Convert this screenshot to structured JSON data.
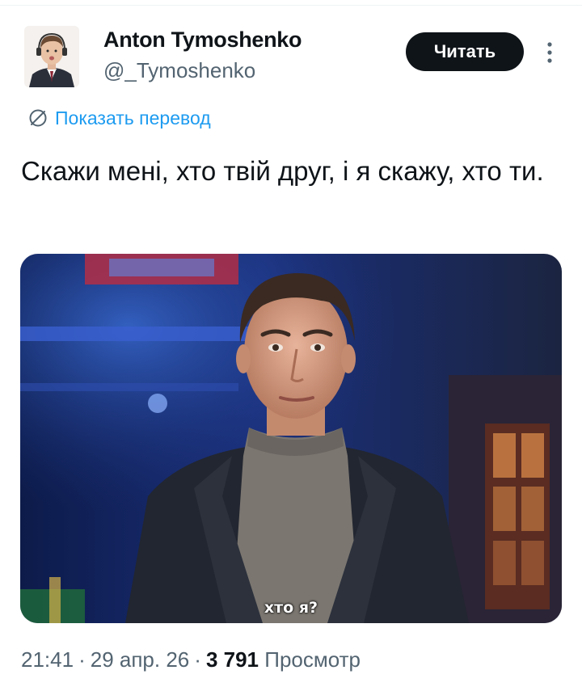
{
  "author": {
    "name": "Anton Tymoshenko",
    "handle": "@_Tymoshenko"
  },
  "follow_button": {
    "label": "Читать"
  },
  "more_icon": "more-vertical-icon",
  "translate": {
    "icon": "translate-globe-icon",
    "label": "Показать перевод"
  },
  "tweet": {
    "text": "Скажи мені, хто твій друг, і я скажу, хто ти."
  },
  "media": {
    "subtitle": "хто я?"
  },
  "meta": {
    "time": "21:41",
    "separator": "·",
    "date": "29 апр. 26",
    "views_count": "3 791",
    "views_label": "Просмотр"
  },
  "colors": {
    "link": "#1d9bf0",
    "secondary_text": "#536471",
    "primary_text": "#0f1419",
    "button_bg": "#0f1419"
  }
}
